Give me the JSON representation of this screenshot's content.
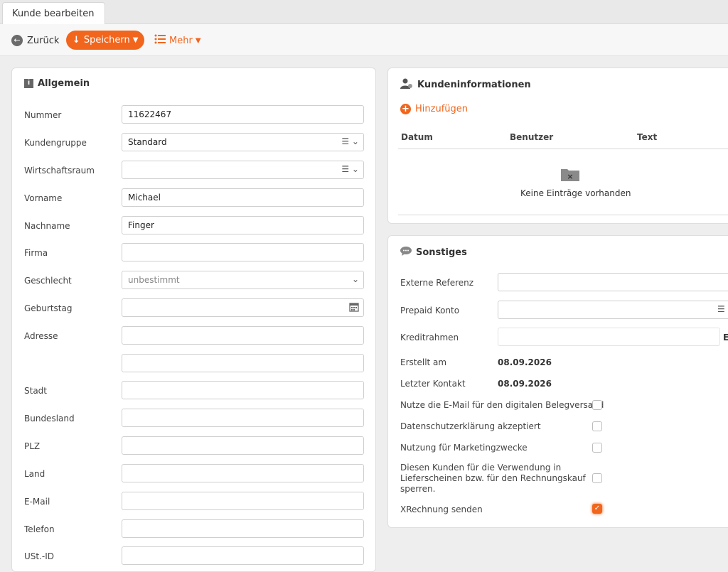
{
  "tab": {
    "label": "Kunde bearbeiten"
  },
  "toolbar": {
    "back_label": "Zurück",
    "save_label": "Speichern",
    "more_label": "Mehr"
  },
  "general": {
    "title": "Allgemein",
    "fields": {
      "nummer": {
        "label": "Nummer",
        "value": "11622467"
      },
      "kundengruppe": {
        "label": "Kundengruppe",
        "value": "Standard"
      },
      "wirtschaftsraum": {
        "label": "Wirtschaftsraum",
        "value": ""
      },
      "vorname": {
        "label": "Vorname",
        "value": "Michael"
      },
      "nachname": {
        "label": "Nachname",
        "value": "Finger"
      },
      "firma": {
        "label": "Firma",
        "value": ""
      },
      "geschlecht": {
        "label": "Geschlecht",
        "value": "unbestimmt"
      },
      "geburtstag": {
        "label": "Geburtstag",
        "value": ""
      },
      "adresse": {
        "label": "Adresse",
        "value": "",
        "value2": ""
      },
      "stadt": {
        "label": "Stadt",
        "value": ""
      },
      "bundesland": {
        "label": "Bundesland",
        "value": ""
      },
      "plz": {
        "label": "PLZ",
        "value": ""
      },
      "land": {
        "label": "Land",
        "value": ""
      },
      "email": {
        "label": "E-Mail",
        "value": ""
      },
      "telefon": {
        "label": "Telefon",
        "value": ""
      },
      "ustid": {
        "label": "USt.-ID",
        "value": ""
      }
    }
  },
  "customer_info": {
    "title": "Kundeninformationen",
    "add_label": "Hinzufügen",
    "columns": [
      "Datum",
      "Benutzer",
      "Text"
    ],
    "empty_text": "Keine Einträge vorhanden"
  },
  "misc": {
    "title": "Sonstiges",
    "externe_referenz": {
      "label": "Externe Referenz",
      "value": ""
    },
    "prepaid_konto": {
      "label": "Prepaid Konto",
      "value": ""
    },
    "kreditrahmen": {
      "label": "Kreditrahmen",
      "value": "",
      "suffix": "E"
    },
    "erstellt_am": {
      "label": "Erstellt am",
      "value": "08.09.2026"
    },
    "letzter_kontakt": {
      "label": "Letzter Kontakt",
      "value": "08.09.2026"
    },
    "checkboxes": [
      {
        "label": "Nutze die E-Mail für den digitalen Belegversand",
        "checked": false
      },
      {
        "label": "Datenschutzerklärung akzeptiert",
        "checked": false
      },
      {
        "label": "Nutzung für Marketingzwecke",
        "checked": false
      },
      {
        "label_lines": [
          "Diesen Kunden für die Verwendung in",
          "Lieferscheinen bzw. für den Rechnungskauf",
          "sperren."
        ],
        "checked": false
      },
      {
        "label": "XRechnung senden",
        "checked": true
      }
    ]
  },
  "colors": {
    "accent": "#f2651c",
    "background": "#eeeeee"
  }
}
